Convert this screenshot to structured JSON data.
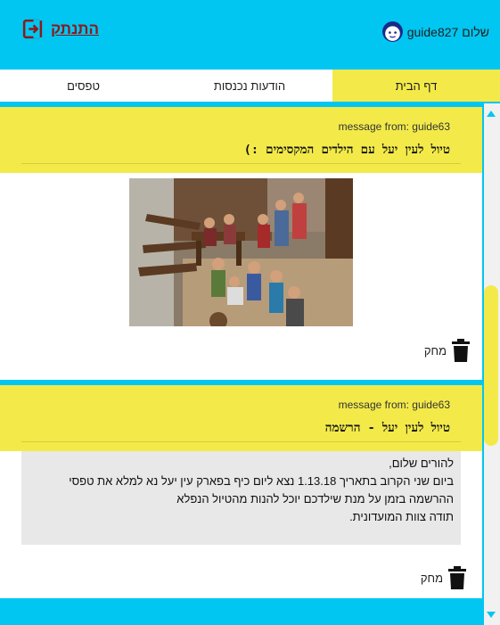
{
  "header": {
    "greeting": "שלום guide827",
    "logout_label": "התנתק"
  },
  "tabs": [
    {
      "label": "דף הבית",
      "active": true
    },
    {
      "label": "הודעות נכנסות",
      "active": false
    },
    {
      "label": "טפסים",
      "active": false
    }
  ],
  "messages": [
    {
      "from": "message from: guide63",
      "title": "טיול לעין יעל עם הילדים המקסימים :)",
      "has_photo": true,
      "delete_label": "מחק"
    },
    {
      "from": "message from: guide63",
      "title": "טיול לעין יעל - הרשמה",
      "body_lines": [
        "להורים שלום,",
        "ביום שני הקרוב בתאריך 1.13.18 נצא ליום כיף בפארק עין יעל נא למלא את טפסי",
        "ההרשמה בזמן על מנת שילדכם יוכל להנות מהטיול הנפלא",
        "תודה צוות המועדונית."
      ],
      "delete_label": "מחק"
    }
  ],
  "colors": {
    "primary": "#00c6f1",
    "accent": "#f3ea4a",
    "logout": "#8b1a1a"
  },
  "icons": {
    "avatar": "boy-face-icon",
    "logout": "logout-icon",
    "delete": "trash-icon"
  }
}
